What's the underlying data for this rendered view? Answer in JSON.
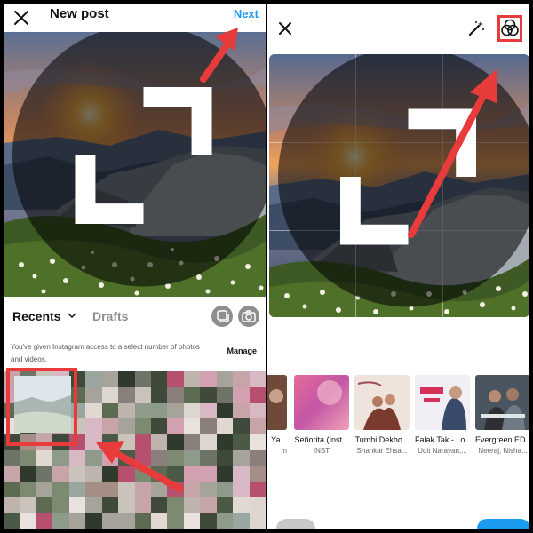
{
  "left_panel": {
    "title": "New post",
    "next_label": "Next",
    "recents_label": "Recents",
    "drafts_label": "Drafts",
    "access_note": "You've given Instagram access to a select number of photos and videos.",
    "manage_label": "Manage"
  },
  "right_panel": {
    "music_tracks": [
      {
        "title": "Ya...",
        "artist": "m"
      },
      {
        "title": "Señorita (Inst...",
        "artist": "INST"
      },
      {
        "title": "Tumhi Dekho...",
        "artist": "Shankar Ehsa..."
      },
      {
        "title": "Falak Tak - Lo...",
        "artist": "Udit Narayan,..."
      },
      {
        "title": "Evergreen ED...",
        "artist": "Neeraj, Nisha..."
      }
    ]
  },
  "colors": {
    "accent_blue": "#1a9bf0",
    "highlight_red": "#e83b3b"
  }
}
